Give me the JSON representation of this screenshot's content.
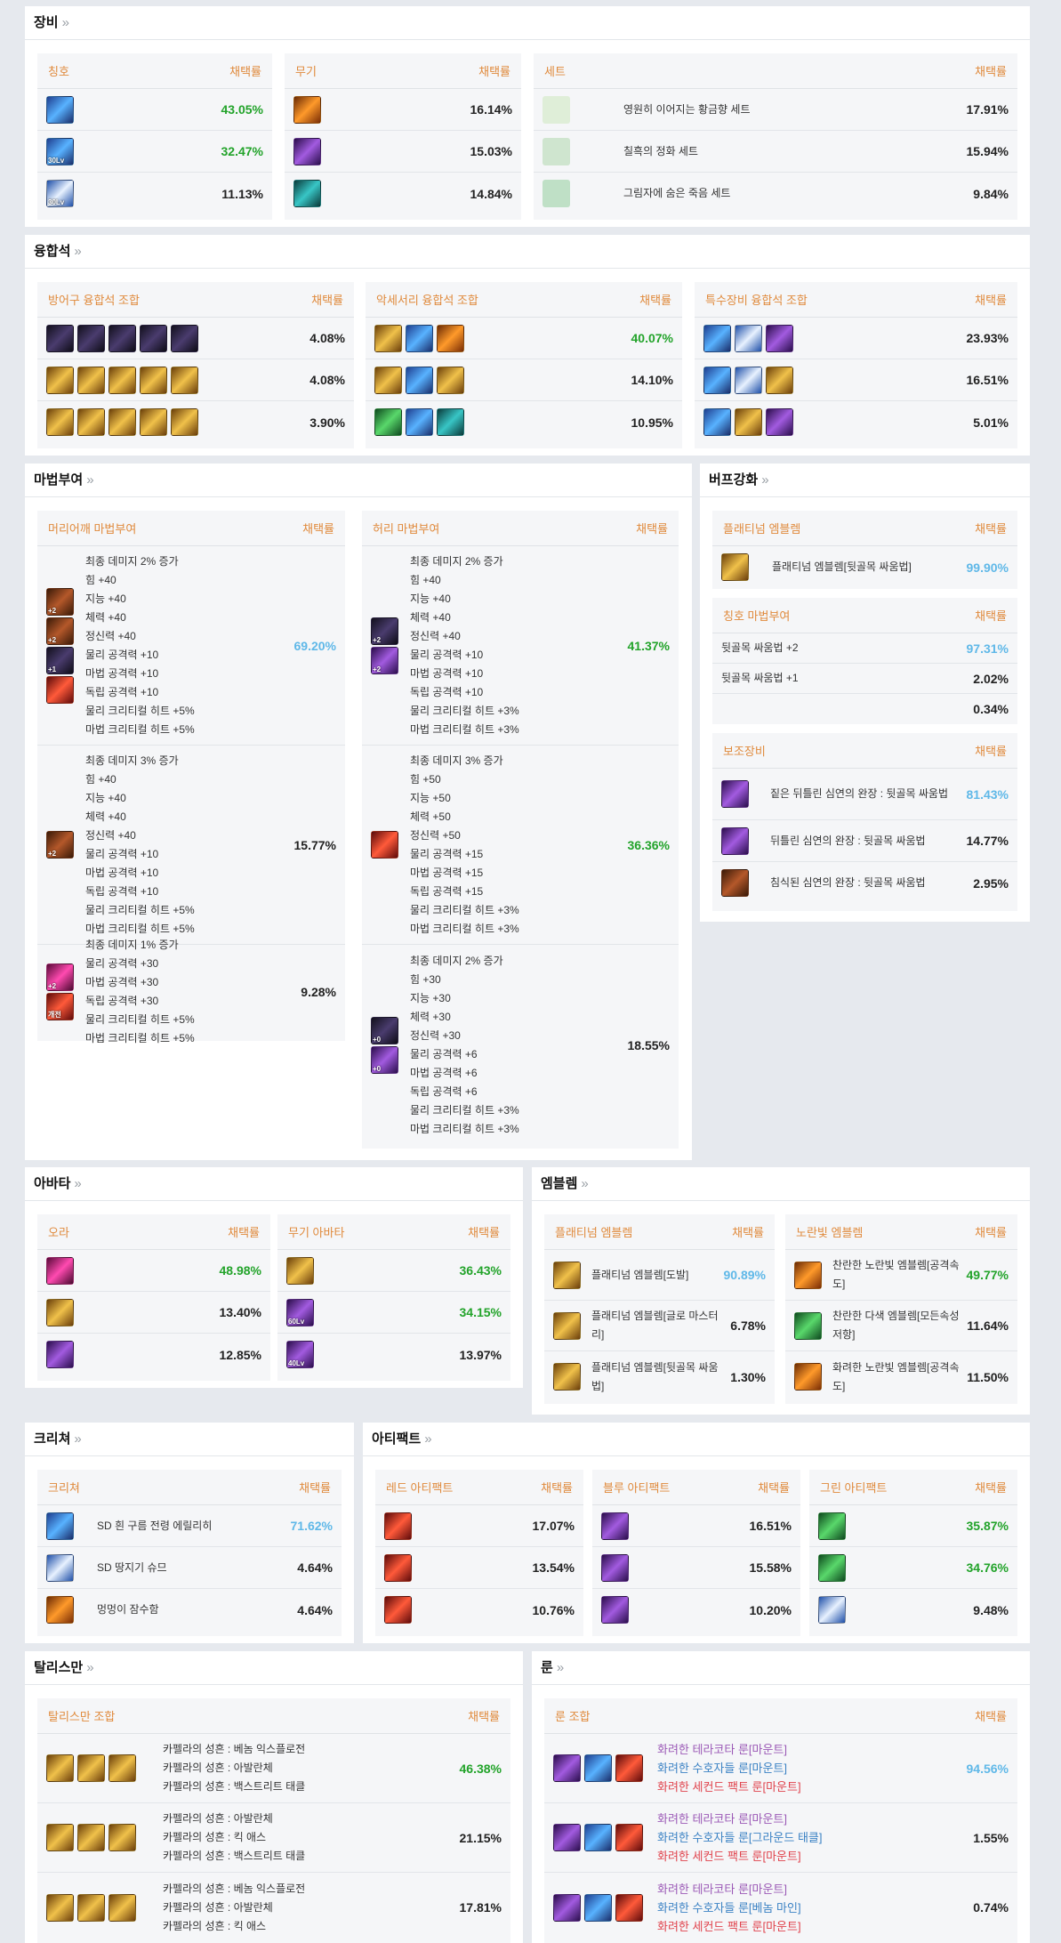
{
  "sections": {
    "equip": {
      "title": "장비",
      "chev": "»"
    },
    "fusion": {
      "title": "융합석",
      "chev": "»"
    },
    "enchant": {
      "title": "마법부여",
      "chev": "»"
    },
    "buff": {
      "title": "버프강화",
      "chev": "»"
    },
    "avatar": {
      "title": "아바타",
      "chev": "»"
    },
    "emblem": {
      "title": "엠블렘",
      "chev": "»"
    },
    "creature": {
      "title": "크리쳐",
      "chev": "»"
    },
    "artifact": {
      "title": "아티팩트",
      "chev": "»"
    },
    "talisman": {
      "title": "탈리스만",
      "chev": "»"
    },
    "rune": {
      "title": "룬",
      "chev": "»"
    }
  },
  "rate_label": "채택률",
  "equip": {
    "title_panel": {
      "label": "칭호",
      "rows": [
        {
          "icon": "title-icon",
          "badge": "",
          "pct": "43.05%"
        },
        {
          "icon": "title-icon",
          "badge": "30Lv",
          "pct": "32.47%"
        },
        {
          "icon": "title-icon",
          "badge": "30Lv",
          "pct": "11.13%"
        }
      ]
    },
    "weapon_panel": {
      "label": "무기",
      "rows": [
        {
          "icon": "weapon-icon",
          "pct": "16.14%"
        },
        {
          "icon": "weapon-icon",
          "pct": "15.03%"
        },
        {
          "icon": "weapon-icon",
          "pct": "14.84%"
        }
      ]
    },
    "set_panel": {
      "label": "세트",
      "rows": [
        {
          "icon": "set-icon",
          "name": "영원히 이어지는 황금향 세트",
          "pct": "17.91%"
        },
        {
          "icon": "set-icon",
          "name": "칠흑의 정화 세트",
          "pct": "15.94%"
        },
        {
          "icon": "set-icon",
          "name": "그림자에 숨은 죽음 세트",
          "pct": "9.84%"
        }
      ]
    }
  },
  "fusion": {
    "armor": {
      "label": "방어구 융합석 조합",
      "rows": [
        {
          "pct": "4.08%"
        },
        {
          "pct": "4.08%"
        },
        {
          "pct": "3.90%"
        }
      ]
    },
    "accessory": {
      "label": "악세서리 융합석 조합",
      "rows": [
        {
          "pct": "40.07%"
        },
        {
          "pct": "14.10%"
        },
        {
          "pct": "10.95%"
        }
      ]
    },
    "special": {
      "label": "특수장비 융합석 조합",
      "rows": [
        {
          "pct": "23.93%"
        },
        {
          "pct": "16.51%"
        },
        {
          "pct": "5.01%"
        }
      ]
    }
  },
  "enchant": {
    "shoulder": {
      "label": "머리어깨 마법부여",
      "rows": [
        {
          "badges": [
            "+2",
            "+2",
            "+1",
            ""
          ],
          "lines": [
            "최종 데미지 2% 증가",
            "힘 +40",
            "지능 +40",
            "체력 +40",
            "정신력 +40",
            "물리 공격력 +10",
            "마법 공격력 +10",
            "독립 공격력 +10",
            "물리 크리티컬 히트 +5%",
            "마법 크리티컬 히트 +5%"
          ],
          "pct": "69.20%"
        },
        {
          "badges": [
            "+2"
          ],
          "lines": [
            "최종 데미지 3% 증가",
            "힘 +40",
            "지능 +40",
            "체력 +40",
            "정신력 +40",
            "물리 공격력 +10",
            "마법 공격력 +10",
            "독립 공격력 +10",
            "물리 크리티컬 히트 +5%",
            "마법 크리티컬 히트 +5%"
          ],
          "pct": "15.77%"
        },
        {
          "badges": [
            "+2",
            "개전"
          ],
          "lines": [
            "최종 데미지 1% 증가",
            "물리 공격력 +30",
            "마법 공격력 +30",
            "독립 공격력 +30",
            "물리 크리티컬 히트 +5%",
            "마법 크리티컬 히트 +5%"
          ],
          "pct": "9.28%"
        }
      ]
    },
    "waist": {
      "label": "허리 마법부여",
      "rows": [
        {
          "badges": [
            "+2",
            "+2"
          ],
          "lines": [
            "최종 데미지 2% 증가",
            "힘 +40",
            "지능 +40",
            "체력 +40",
            "정신력 +40",
            "물리 공격력 +10",
            "마법 공격력 +10",
            "독립 공격력 +10",
            "물리 크리티컬 히트 +3%",
            "마법 크리티컬 히트 +3%"
          ],
          "pct": "41.37%"
        },
        {
          "badges": [
            ""
          ],
          "lines": [
            "최종 데미지 3% 증가",
            "힘 +50",
            "지능 +50",
            "체력 +50",
            "정신력 +50",
            "물리 공격력 +15",
            "마법 공격력 +15",
            "독립 공격력 +15",
            "물리 크리티컬 히트 +3%",
            "마법 크리티컬 히트 +3%"
          ],
          "pct": "36.36%"
        },
        {
          "badges": [
            "+0",
            "+0"
          ],
          "lines": [
            "최종 데미지 2% 증가",
            "힘 +30",
            "지능 +30",
            "체력 +30",
            "정신력 +30",
            "물리 공격력 +6",
            "마법 공격력 +6",
            "독립 공격력 +6",
            "물리 크리티컬 히트 +3%",
            "마법 크리티컬 히트 +3%"
          ],
          "pct": "18.55%"
        }
      ]
    }
  },
  "buff": {
    "platinum": {
      "label": "플래티넘 엠블렘",
      "rows": [
        {
          "name": "플래티넘 엠블렘[뒷골목 싸움법]",
          "pct": "99.90%"
        }
      ]
    },
    "title_enchant": {
      "label": "칭호 마법부여",
      "rows": [
        {
          "name": "뒷골목 싸움법 +2",
          "pct": "97.31%"
        },
        {
          "name": "뒷골목 싸움법 +1",
          "pct": "2.02%"
        },
        {
          "name": "",
          "pct": "0.34%"
        }
      ]
    },
    "sub": {
      "label": "보조장비",
      "rows": [
        {
          "name": "짙은 뒤틀린 심연의 완장 : 뒷골목 싸움법",
          "pct": "81.43%"
        },
        {
          "name": "뒤틀린 심연의 완장 : 뒷골목 싸움법",
          "pct": "14.77%"
        },
        {
          "name": "침식된 심연의 완장 : 뒷골목 싸움법",
          "pct": "2.95%"
        }
      ]
    }
  },
  "avatar": {
    "aura": {
      "label": "오라",
      "rows": [
        {
          "pct": "48.98%"
        },
        {
          "pct": "13.40%"
        },
        {
          "pct": "12.85%"
        }
      ]
    },
    "weapon": {
      "label": "무기 아바타",
      "rows": [
        {
          "badge": "",
          "pct": "36.43%"
        },
        {
          "badge": "60Lv",
          "pct": "34.15%"
        },
        {
          "badge": "40Lv",
          "pct": "13.97%"
        }
      ]
    }
  },
  "emblem": {
    "platinum": {
      "label": "플래티넘 엠블렘",
      "rows": [
        {
          "name": "플래티넘 엠블렘[도발]",
          "pct": "90.89%"
        },
        {
          "name": "플래티넘 엠블렘[글로 마스터리]",
          "pct": "6.78%"
        },
        {
          "name": "플래티넘 엠블렘[뒷골목 싸움법]",
          "pct": "1.30%"
        }
      ]
    },
    "yellow": {
      "label": "노란빛 엠블렘",
      "rows": [
        {
          "name": "찬란한 노란빛 엠블렘[공격속도]",
          "pct": "49.77%"
        },
        {
          "name": "찬란한 다색 엠블렘[모든속성저항]",
          "pct": "11.64%"
        },
        {
          "name": "화려한 노란빛 엠블렘[공격속도]",
          "pct": "11.50%"
        }
      ]
    }
  },
  "creature": {
    "label": "크리쳐",
    "rows": [
      {
        "name": "SD 흰 구름 전령 에릴리히",
        "pct": "71.62%"
      },
      {
        "name": "SD 땅지기 슈므",
        "pct": "4.64%"
      },
      {
        "name": "멍멍이 잠수함",
        "pct": "4.64%"
      }
    ]
  },
  "artifact": {
    "red": {
      "label": "레드 아티팩트",
      "rows": [
        {
          "pct": "17.07%"
        },
        {
          "pct": "13.54%"
        },
        {
          "pct": "10.76%"
        }
      ]
    },
    "blue": {
      "label": "블루 아티팩트",
      "rows": [
        {
          "pct": "16.51%"
        },
        {
          "pct": "15.58%"
        },
        {
          "pct": "10.20%"
        }
      ]
    },
    "green": {
      "label": "그린 아티팩트",
      "rows": [
        {
          "pct": "35.87%"
        },
        {
          "pct": "34.76%"
        },
        {
          "pct": "9.48%"
        }
      ]
    }
  },
  "talisman": {
    "label": "탈리스만 조합",
    "rows": [
      {
        "lines": [
          "카펠라의 성흔 : 베놈 익스플로전",
          "카펠라의 성흔 : 아발란체",
          "카펠라의 성흔 : 백스트리트 태클"
        ],
        "pct": "46.38%"
      },
      {
        "lines": [
          "카펠라의 성흔 : 아발란체",
          "카펠라의 성흔 : 킥 애스",
          "카펠라의 성흔 : 백스트리트 태클"
        ],
        "pct": "21.15%"
      },
      {
        "lines": [
          "카펠라의 성흔 : 베놈 익스플로전",
          "카펠라의 성흔 : 아발란체",
          "카펠라의 성흔 : 킥 애스"
        ],
        "pct": "17.81%"
      }
    ]
  },
  "rune": {
    "label": "룬 조합",
    "rows": [
      {
        "lines": [
          "화려한 테라코타 룬[마운트]",
          "화려한 수호자들 룬[마운트]",
          "화려한 세컨드 팩트 룬[마운트]"
        ],
        "pct": "94.56%"
      },
      {
        "lines": [
          "화려한 테라코타 룬[마운트]",
          "화려한 수호자들 룬[그라운드 태클]",
          "화려한 세컨드 팩트 룬[마운트]"
        ],
        "pct": "1.55%"
      },
      {
        "lines": [
          "화려한 테라코타 룬[마운트]",
          "화려한 수호자들 룬[베놈 마인]",
          "화려한 세컨드 팩트 룬[마운트]"
        ],
        "pct": "0.74%"
      }
    ]
  },
  "colors": {
    "accent": "#e08a3c",
    "green": "#22a32a",
    "blue": "#5fb8e8"
  }
}
